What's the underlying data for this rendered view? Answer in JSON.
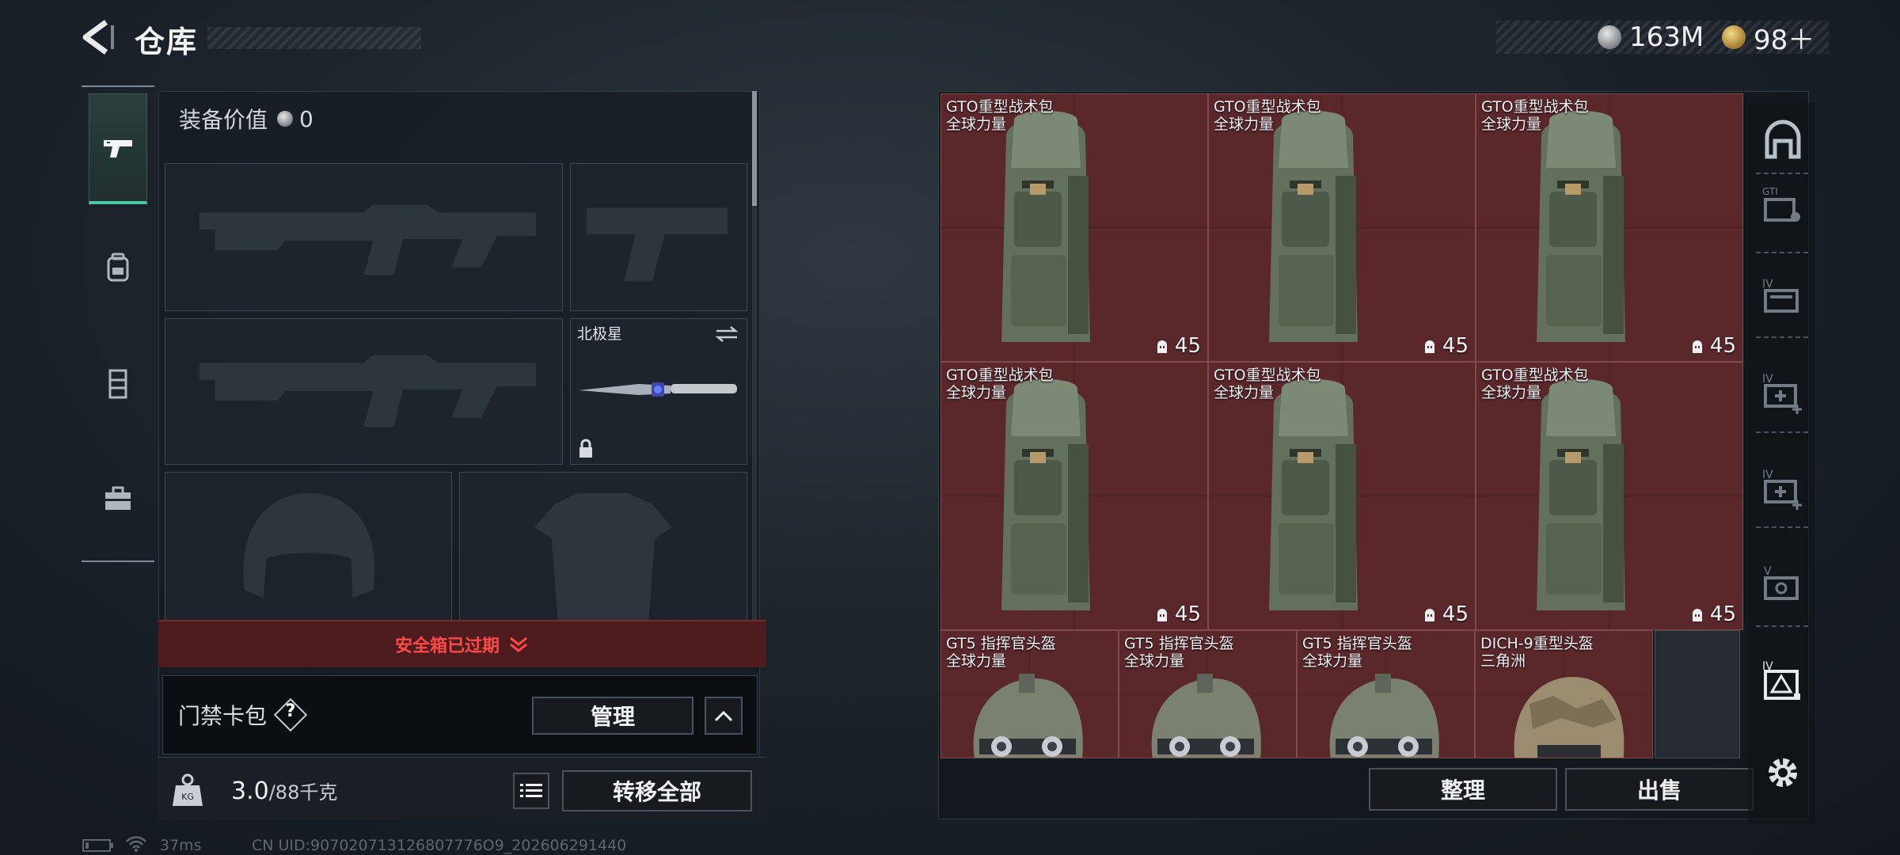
{
  "header": {
    "title": "仓库",
    "currency_silver": "163M",
    "currency_gold": "98＋"
  },
  "left_tabs": [
    {
      "name": "weapons",
      "icon": "pistol-icon",
      "active": true
    },
    {
      "name": "backpack",
      "icon": "backpack-icon",
      "active": false
    },
    {
      "name": "vest",
      "icon": "vest-icon",
      "active": false
    },
    {
      "name": "toolbox",
      "icon": "toolbox-icon",
      "active": false
    }
  ],
  "equipment": {
    "value_label": "装备价值",
    "value_amount": "0",
    "melee_slot_label": "北极星",
    "safe_box_status": "安全箱已过期",
    "card_pack_label": "门禁卡包",
    "help_mark": "?",
    "manage_label": "管理",
    "capacity_current": "3.0",
    "capacity_max": "/88千克",
    "transfer_all_label": "转移全部"
  },
  "storage": {
    "items": [
      {
        "name": "GTO重型战术包",
        "sub": "全球力量",
        "count": "45",
        "kind": "backpack"
      },
      {
        "name": "GTO重型战术包",
        "sub": "全球力量",
        "count": "45",
        "kind": "backpack"
      },
      {
        "name": "GTO重型战术包",
        "sub": "全球力量",
        "count": "45",
        "kind": "backpack"
      },
      {
        "name": "GTO重型战术包",
        "sub": "全球力量",
        "count": "45",
        "kind": "backpack"
      },
      {
        "name": "GTO重型战术包",
        "sub": "全球力量",
        "count": "45",
        "kind": "backpack"
      },
      {
        "name": "GTO重型战术包",
        "sub": "全球力量",
        "count": "45",
        "kind": "backpack"
      },
      {
        "name": "GT5 指挥官头盔",
        "sub": "全球力量",
        "kind": "helmet"
      },
      {
        "name": "GT5 指挥官头盔",
        "sub": "全球力量",
        "kind": "helmet"
      },
      {
        "name": "GT5 指挥官头盔",
        "sub": "全球力量",
        "kind": "helmet"
      },
      {
        "name": "DICH-9重型头盔",
        "sub": "三角洲",
        "kind": "helmet-tan"
      }
    ],
    "organize_label": "整理",
    "sell_label": "出售"
  },
  "right_rail_icons": [
    "home-icon",
    "gti-tag-icon",
    "iv-folder-icon",
    "iv-medkit-icon",
    "iv-medkit-plus-icon",
    "v-radio-icon",
    "iv-warning-icon",
    "settings-gear-icon"
  ],
  "status_bar": {
    "ping": "37ms",
    "uid": "CN UID:907020713126807776O9_202606291440"
  },
  "colors": {
    "accent": "#4fc7a4",
    "item_bg": "#5a272b",
    "alert_red": "#ff4a48"
  }
}
